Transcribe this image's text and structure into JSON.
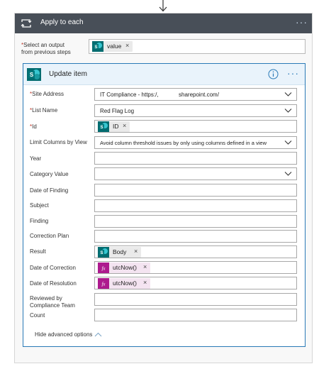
{
  "loop": {
    "title": "Apply to each",
    "more": "···",
    "select_label_req": "*",
    "select_label_line1": "Select an output",
    "select_label_line2": "from previous steps",
    "select_token": "value"
  },
  "action": {
    "title": "Update item",
    "more": "···",
    "rows": {
      "site_address": {
        "req": "*",
        "label": "Site Address",
        "value_a": "IT Compliance - https:/,",
        "value_b": "sharepoint.com/"
      },
      "list_name": {
        "req": "*",
        "label": "List Name",
        "value": "Red Flag Log"
      },
      "id": {
        "req": "*",
        "label": "Id",
        "token": "ID"
      },
      "limit_columns": {
        "label": "Limit Columns by View",
        "value": "Avoid column threshold issues by only using columns defined in a view"
      },
      "year": {
        "label": "Year"
      },
      "category_value": {
        "label": "Category Value"
      },
      "date_of_finding": {
        "label": "Date of Finding"
      },
      "subject": {
        "label": "Subject"
      },
      "finding": {
        "label": "Finding"
      },
      "correction_plan": {
        "label": "Correction Plan"
      },
      "result": {
        "label": "Result",
        "token": "Body"
      },
      "date_of_correction": {
        "label": "Date of Correction",
        "token": "utcNow()"
      },
      "date_of_resolution": {
        "label": "Date of Resolution",
        "token": "utcNow()"
      },
      "reviewed_by": {
        "label_line1": "Reviewed by",
        "label_line2": "Compliance Team"
      },
      "count": {
        "label": "Count"
      }
    },
    "hide_advanced": "Hide advanced options"
  },
  "token_remove": "×",
  "fx_glyph": "fx",
  "colors": {
    "loop_header": "#484f58",
    "action_border": "#2a7ab7",
    "sharepoint": "#036c70",
    "expression": "#ad1a8e",
    "required": "#c0392b"
  }
}
